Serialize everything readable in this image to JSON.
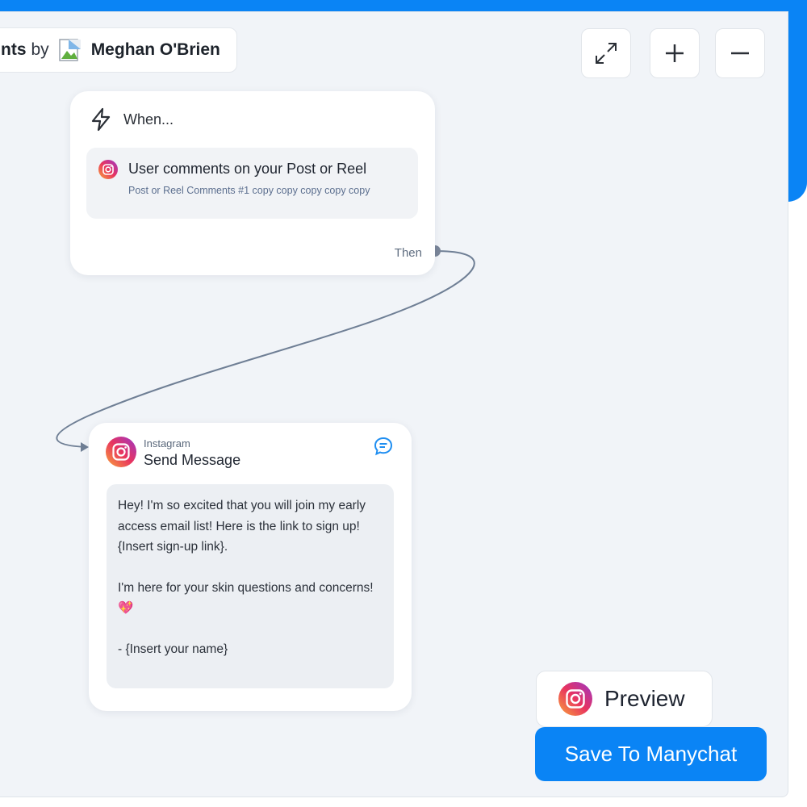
{
  "header": {
    "title_fragment": "nts",
    "by_label": "by",
    "author_name": "Meghan O'Brien"
  },
  "controls": {
    "icons": [
      "expand-icon",
      "zoom-in-icon",
      "zoom-out-icon"
    ]
  },
  "trigger": {
    "when_label": "When...",
    "title": "User comments on your Post or Reel",
    "subtitle": "Post or Reel Comments #1 copy copy copy copy copy",
    "then_label": "Then"
  },
  "message": {
    "platform": "Instagram",
    "title": "Send Message",
    "lines_1": "Hey! I'm so excited that you will join my early access email list! Here is the link to sign up! {Insert sign-up link}.",
    "lines_2": "I'm here for your skin questions and concerns! 💖",
    "lines_3": "- {Insert your name}"
  },
  "actions": {
    "preview_label": "Preview",
    "save_label": "Save To Manychat"
  },
  "colors": {
    "accent": "#0a84f5",
    "canvas": "#f1f4f8",
    "connector": "#6f7f95"
  }
}
